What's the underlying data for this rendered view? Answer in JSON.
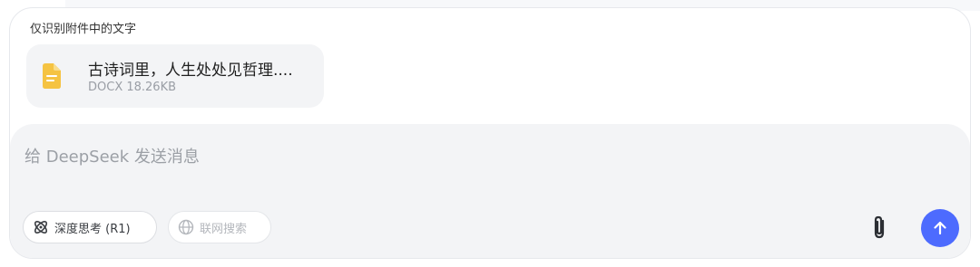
{
  "background_hint": "",
  "attachment": {
    "header": "仅识别附件中的文字",
    "file": {
      "name": "古诗词里，人生处处见哲理....",
      "meta": "DOCX 18.26KB",
      "icon": "document-icon",
      "icon_color": "#f5c342"
    }
  },
  "input": {
    "placeholder": "给 DeepSeek 发送消息"
  },
  "toolbar": {
    "deep_think_label": "深度思考 (R1)",
    "web_search_label": "联网搜索",
    "attach_icon": "paperclip-icon",
    "send_icon": "arrow-up-icon",
    "send_color": "#4d6bfe"
  },
  "footer_hint": ""
}
